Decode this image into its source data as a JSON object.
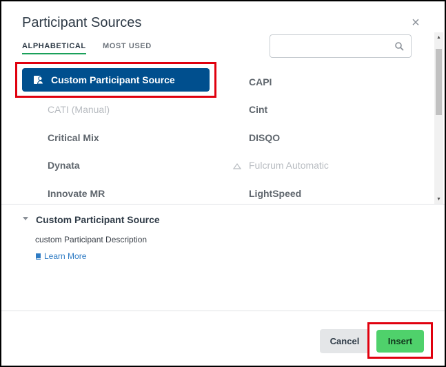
{
  "dialog": {
    "title": "Participant Sources",
    "close_label": "×"
  },
  "tabs": [
    {
      "label": "ALPHABETICAL",
      "active": true
    },
    {
      "label": "MOST USED",
      "active": false
    }
  ],
  "search": {
    "placeholder": "",
    "value": ""
  },
  "sources": {
    "selected": "Custom Participant Source",
    "items": [
      {
        "label": "CAPI",
        "disabled": false
      },
      {
        "label": "CATI (Manual)",
        "disabled": true
      },
      {
        "label": "Cint",
        "disabled": false
      },
      {
        "label": "Critical Mix",
        "disabled": false
      },
      {
        "label": "DISQO",
        "disabled": false
      },
      {
        "label": "Dynata",
        "disabled": false
      },
      {
        "label": "Fulcrum Automatic",
        "disabled": true
      },
      {
        "label": "Innovate MR",
        "disabled": false
      },
      {
        "label": "LightSpeed",
        "disabled": false
      }
    ]
  },
  "detail": {
    "title": "Custom Participant Source",
    "description": "custom Participant Description",
    "learn_more": "Learn More"
  },
  "footer": {
    "cancel_label": "Cancel",
    "insert_label": "Insert"
  },
  "colors": {
    "accent_blue": "#004f8e",
    "insert_green": "#4fd16b",
    "tab_underline": "#1aa05a",
    "highlight_red": "#e0000e"
  }
}
